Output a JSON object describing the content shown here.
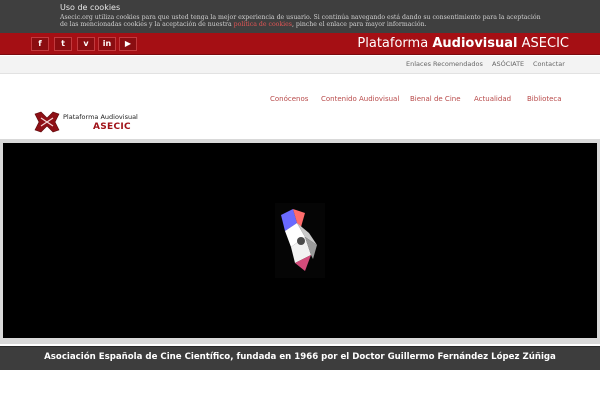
{
  "cookie_banner": {
    "title": "Uso de cookies",
    "text_part1": "Asecic.org utiliza cookies para que usted tenga la mejor experiencia de usuario. Si continúa navegando está dando su consentimiento para la aceptación de las mencionadas cookies y la aceptación de nuestra ",
    "link_text": "política de cookies",
    "text_part2": ", pinche el enlace para mayor información."
  },
  "social": {
    "items": [
      {
        "icon": "facebook-icon",
        "glyph": "f"
      },
      {
        "icon": "twitter-icon",
        "glyph": "t"
      },
      {
        "icon": "vimeo-icon",
        "glyph": "v"
      },
      {
        "icon": "linkedin-icon",
        "glyph": "in"
      },
      {
        "icon": "youtube-icon",
        "glyph": "▶"
      }
    ]
  },
  "brand": {
    "prefix": "Plataforma",
    "bold": "Audiovisual",
    "suffix": "ASECIC"
  },
  "top_links": [
    "Enlaces Recomendados",
    "ASÓCIATE",
    "Contactar"
  ],
  "logo": {
    "line1": "Plataforma Audiovisual",
    "line2": "ASECIC"
  },
  "nav": [
    "Conócenos",
    "Contenido Audiovisual",
    "Bienal de Cine",
    "Actualidad",
    "Biblioteca"
  ],
  "caption": "Asociación Española de Cine Científico, fundada en 1966 por el Doctor Guillermo Fernández López Zúñiga",
  "colors": {
    "brand_red": "#a50f14",
    "nav_text": "#b84a4a",
    "dark_band": "#3d3d3d"
  }
}
